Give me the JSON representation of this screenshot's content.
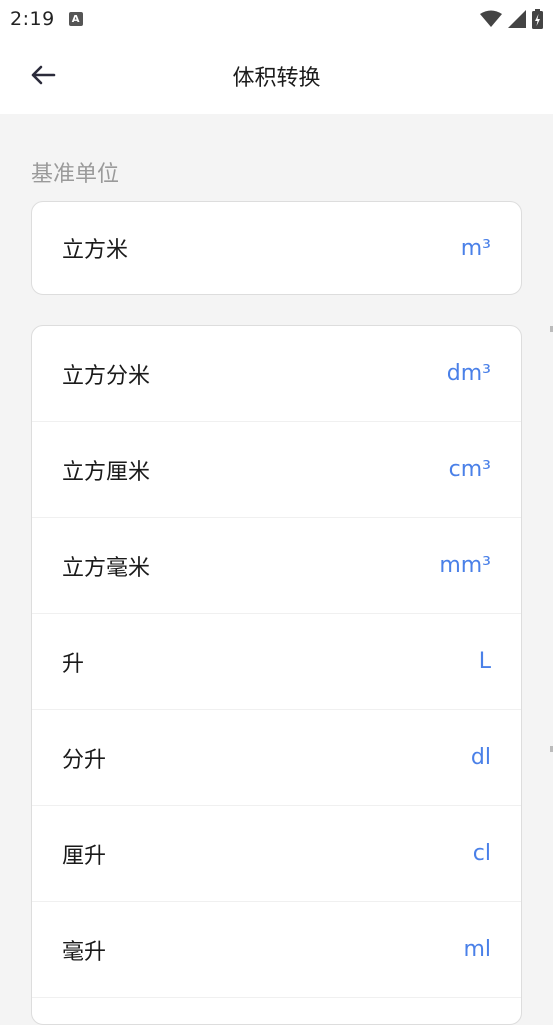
{
  "status_bar": {
    "time": "2:19",
    "notification_glyph": "A",
    "icons": [
      "wifi-icon",
      "signal-icon",
      "battery-icon"
    ]
  },
  "app_bar": {
    "title": "体积转换",
    "back_icon": "arrow-left-icon"
  },
  "base": {
    "section_label": "基准单位",
    "unit": {
      "name": "立方米",
      "symbol": "m³"
    }
  },
  "units": [
    {
      "name": "立方分米",
      "symbol": "dm³"
    },
    {
      "name": "立方厘米",
      "symbol": "cm³"
    },
    {
      "name": "立方毫米",
      "symbol": "mm³"
    },
    {
      "name": "升",
      "symbol": "L"
    },
    {
      "name": "分升",
      "symbol": "dl"
    },
    {
      "name": "厘升",
      "symbol": "cl"
    },
    {
      "name": "毫升",
      "symbol": "ml"
    }
  ],
  "colors": {
    "accent": "#4a80e8",
    "background": "#f4f4f4",
    "card": "#ffffff",
    "label_gray": "#9a9a9a"
  }
}
